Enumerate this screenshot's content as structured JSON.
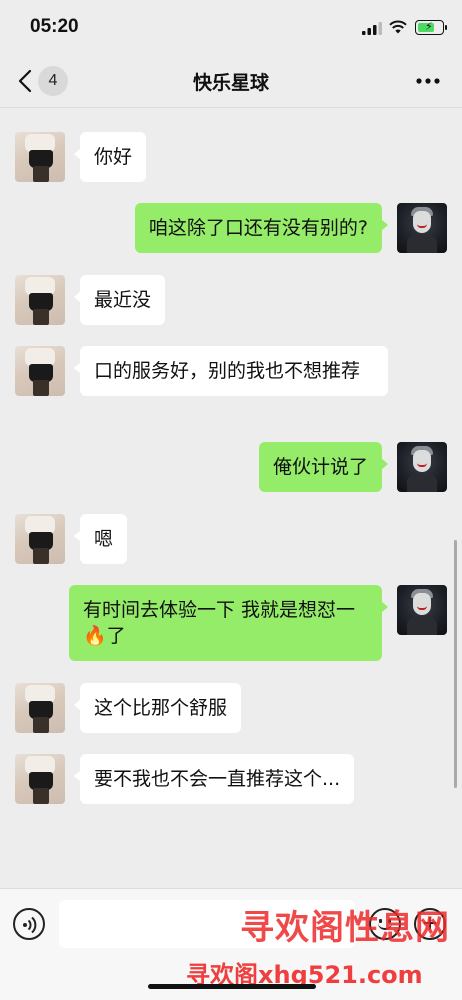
{
  "status_bar": {
    "time": "05:20",
    "icons": [
      "signal-icon",
      "wifi-icon",
      "battery-charging-icon"
    ]
  },
  "header": {
    "back_icon": "chevron-left-icon",
    "unread_count": "4",
    "title": "快乐星球",
    "more_icon": "more-dots-icon"
  },
  "messages": [
    {
      "side": "in",
      "avatar": "contact-avatar",
      "text": "你好"
    },
    {
      "side": "out",
      "avatar": "my-avatar",
      "text": "咱这除了口还有没有别的?"
    },
    {
      "side": "in",
      "avatar": "contact-avatar",
      "text": "最近没"
    },
    {
      "side": "in",
      "avatar": "contact-avatar",
      "text": "口的服务好，别的我也不想推荐"
    },
    {
      "side": "out",
      "avatar": "my-avatar",
      "text": "俺伙计说了"
    },
    {
      "side": "in",
      "avatar": "contact-avatar",
      "text": "嗯"
    },
    {
      "side": "out",
      "avatar": "my-avatar",
      "text": "有时间去体验一下 我就是想怼一🔥了"
    },
    {
      "side": "in",
      "avatar": "contact-avatar",
      "text": "这个比那个舒服"
    },
    {
      "side": "in",
      "avatar": "contact-avatar",
      "text": "要不我也不会一直推荐这个..."
    }
  ],
  "input_bar": {
    "voice_icon": "voice-icon",
    "input_value": "",
    "emoji_icon": "emoji-icon",
    "plus_icon": "plus-icon"
  },
  "watermark": {
    "line1": "寻欢阁性息网",
    "line2": "寻欢阁xhg521.com"
  },
  "colors": {
    "background": "#ededed",
    "incoming_bubble": "#ffffff",
    "outgoing_bubble": "#95ec69",
    "watermark": "#ee2a2a"
  }
}
